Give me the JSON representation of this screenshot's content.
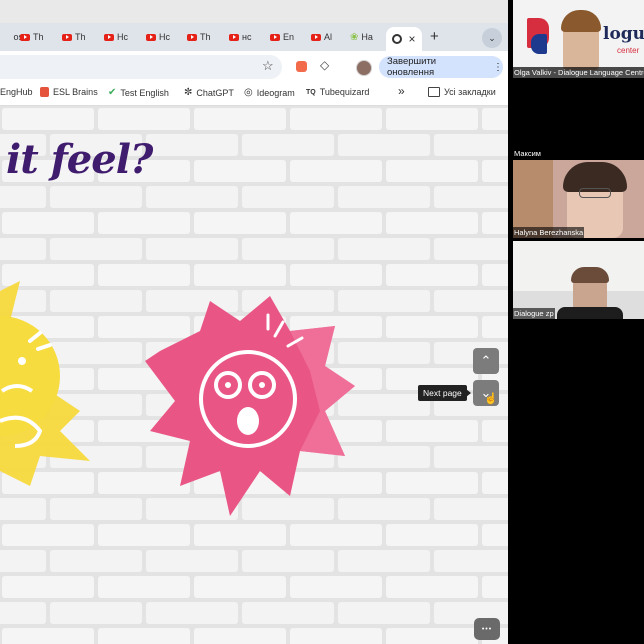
{
  "browser": {
    "tabs": [
      {
        "label": "Th",
        "icon": "youtube-icon"
      },
      {
        "label": "Th",
        "icon": "youtube-icon"
      },
      {
        "label": "Hc",
        "icon": "youtube-icon"
      },
      {
        "label": "Hc",
        "icon": "youtube-icon"
      },
      {
        "label": "Th",
        "icon": "youtube-icon"
      },
      {
        "label": "нс",
        "icon": "youtube-icon"
      },
      {
        "label": "En",
        "icon": "youtube-icon"
      },
      {
        "label": "Al",
        "icon": "youtube-icon"
      },
      {
        "label": "Ha",
        "icon": "tab-icon"
      }
    ],
    "active_tab_close": "×",
    "new_tab": "+",
    "update_button": "Завершити оновлення",
    "bookmarks": [
      {
        "label": "EngHub"
      },
      {
        "label": "ESL Brains"
      },
      {
        "label": "Test English"
      },
      {
        "label": "ChatGPT"
      },
      {
        "label": "Ideogram"
      },
      {
        "label": "Tubequizard"
      }
    ],
    "bookmarks_more": "»",
    "all_bookmarks": "Усі закладки"
  },
  "slide": {
    "heading": "it feel?",
    "tooltip": "Next page",
    "up_glyph": "⌃",
    "down_glyph": "⌄",
    "more_glyph": "•••"
  },
  "participants": [
    {
      "name": "Olga Valkiv - Dialogue Language Centre"
    },
    {
      "name": "Максим"
    },
    {
      "name": "Halyna Berezhanska"
    },
    {
      "name": "Dialogue zp"
    }
  ],
  "logo": {
    "text": "logue",
    "subtext": "center"
  },
  "colors": {
    "sun": "#f6d83c",
    "splash": "#e95685",
    "brick": "#ececec",
    "heading": "#3f1c6e"
  }
}
